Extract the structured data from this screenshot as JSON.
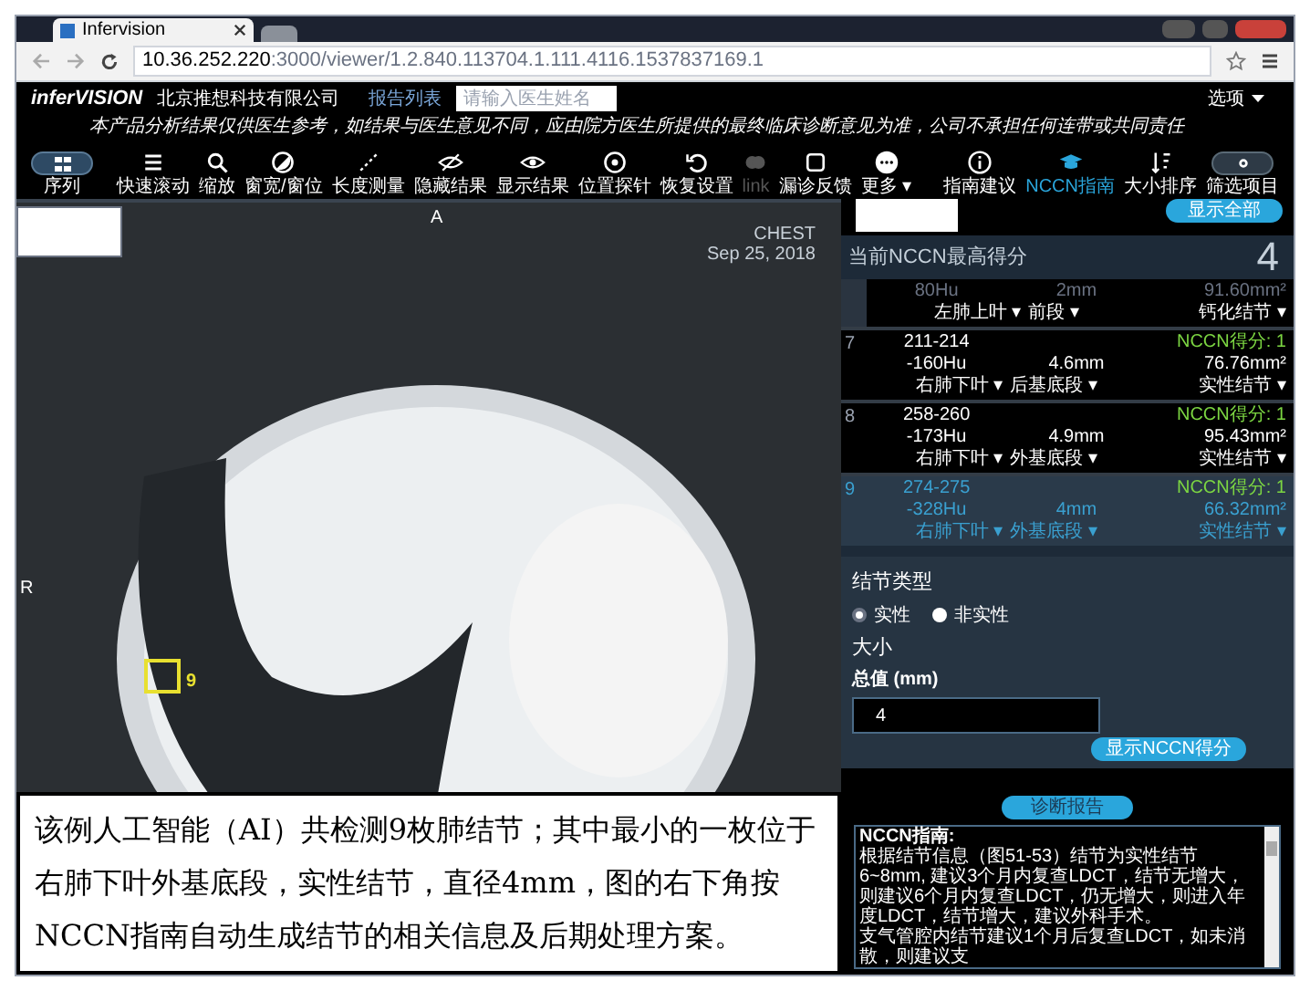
{
  "browser": {
    "tab_title": "Infervision",
    "url_host": "10.36.252.220",
    "url_rest": ":3000/viewer/1.2.840.113704.1.111.4116.1537837169.1"
  },
  "header": {
    "logo": "inferVISION",
    "company": "北京推想科技有限公司",
    "report_link": "报告列表",
    "doctor_search": {
      "placeholder": "请输入医生姓名"
    },
    "options_menu": "选项"
  },
  "disclaimer": "本产品分析结果仅供医生参考，如结果与医生意见不同，应由院方医生所提供的最终临床诊断意见为准，公司不承担任何连带或共同责任",
  "toolbar": {
    "series": "序列",
    "tools": [
      {
        "label": "快速滚动",
        "disabled": false
      },
      {
        "label": "缩放",
        "disabled": false
      },
      {
        "label": "窗宽/窗位",
        "disabled": false
      },
      {
        "label": "长度测量",
        "disabled": false
      },
      {
        "label": "隐藏结果",
        "disabled": false
      },
      {
        "label": "显示结果",
        "disabled": false
      },
      {
        "label": "位置探针",
        "disabled": false
      },
      {
        "label": "恢复设置",
        "disabled": false
      },
      {
        "label": "link",
        "disabled": true
      },
      {
        "label": "漏诊反馈",
        "disabled": false
      },
      {
        "label": "更多 ▾",
        "disabled": false
      }
    ],
    "right_tools": [
      {
        "label": "指南建议",
        "selected": false
      },
      {
        "label": "NCCN指南",
        "selected": true
      },
      {
        "label": "大小排序",
        "selected": false
      },
      {
        "label": "筛选项目",
        "selected": false
      }
    ]
  },
  "viewer": {
    "orientation_top": "A",
    "orientation_left": "R",
    "study": "CHEST",
    "date": "Sep 25, 2018",
    "marker_label": "9"
  },
  "caption": "该例人工智能（AI）共检测9枚肺结节；其中最小的一枚位于右肺下叶外基底段，实性结节，直径4mm，图的右下角按NCCN指南自动生成结节的相关信息及后期处理方案。",
  "panel": {
    "show_all": "显示全部",
    "score_title": "当前NCCN最高得分",
    "score": "4",
    "nodules": [
      {
        "hu": "80Hu",
        "size": "2mm",
        "volume": "91.60mm²",
        "lobe": "左肺上叶 ▾",
        "segment": "前段 ▾",
        "type": "钙化结节 ▾",
        "selected": false
      },
      {
        "index": "7",
        "slices": "211-214",
        "hu": "-160Hu",
        "size": "4.6mm",
        "volume": "76.76mm²",
        "lobe": "右肺下叶 ▾",
        "segment": "后基底段 ▾",
        "type": "实性结节 ▾",
        "score": "NCCN得分: 1",
        "selected": false
      },
      {
        "index": "8",
        "slices": "258-260",
        "hu": "-173Hu",
        "size": "4.9mm",
        "volume": "95.43mm²",
        "lobe": "右肺下叶 ▾",
        "segment": "外基底段 ▾",
        "type": "实性结节 ▾",
        "score": "NCCN得分: 1",
        "selected": false
      },
      {
        "index": "9",
        "slices": "274-275",
        "hu": "-328Hu",
        "size": "4mm",
        "volume": "66.32mm²",
        "lobe": "右肺下叶 ▾",
        "segment": "外基底段 ▾",
        "type": "实性结节 ▾",
        "score": "NCCN得分: 1",
        "selected": true
      }
    ],
    "nodule_type_title": "结节类型",
    "nodule_types": [
      {
        "label": "实性",
        "selected": true
      },
      {
        "label": "非实性",
        "selected": false
      }
    ],
    "size_title": "大小",
    "size_field_label": "总值 (mm)",
    "size_value": "4",
    "show_score_button": "显示NCCN得分",
    "report_button": "诊断报告",
    "guide_title": "NCCN指南:",
    "guide_lines": [
      "根据结节信息（图51-53）结节为实性结节6~8mm, 建议3个月内复查LDCT，结节无增大，则建议6个月内复查LDCT，仍无增大，则进入年度LDCT，结节增大，建议外科手术。",
      "支气管腔内结节建议1个月后复查LDCT，如未消散，则建议支"
    ]
  }
}
